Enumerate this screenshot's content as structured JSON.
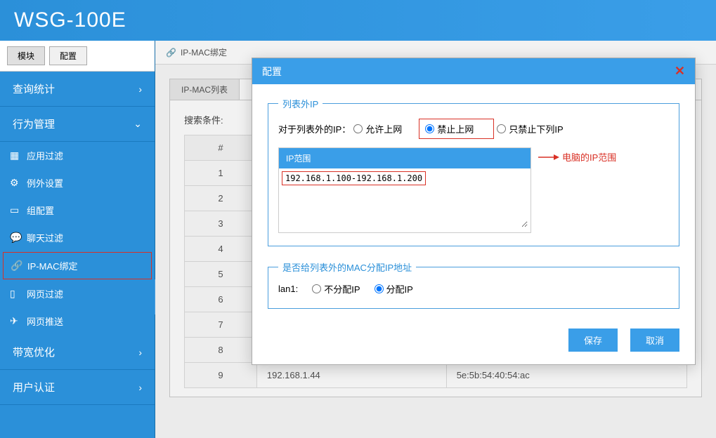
{
  "header": {
    "logo": "WSG-100E"
  },
  "sidebar": {
    "tabs": {
      "module": "模块",
      "config": "配置"
    },
    "sections": [
      {
        "label": "查询统计",
        "expanded": false
      },
      {
        "label": "行为管理",
        "expanded": true,
        "items": [
          {
            "icon": "grid",
            "label": "应用过滤"
          },
          {
            "icon": "gear",
            "label": "例外设置"
          },
          {
            "icon": "card",
            "label": "组配置"
          },
          {
            "icon": "chat",
            "label": "聊天过滤"
          },
          {
            "icon": "link",
            "label": "IP-MAC绑定",
            "highlighted": true
          },
          {
            "icon": "page",
            "label": "网页过滤"
          },
          {
            "icon": "send",
            "label": "网页推送"
          }
        ]
      },
      {
        "label": "带宽优化",
        "expanded": false
      },
      {
        "label": "用户认证",
        "expanded": false
      }
    ]
  },
  "breadcrumb": {
    "text": "IP-MAC绑定"
  },
  "panel": {
    "tab": "IP-MAC列表",
    "search_label": "搜索条件:",
    "rows": [
      "1",
      "2",
      "3",
      "4",
      "5",
      "6",
      "7",
      "8",
      "9"
    ],
    "header": "#",
    "row9_ip": "192.168.1.44",
    "row9_mac": "5e:5b:54:40:54:ac"
  },
  "modal": {
    "title": "配置",
    "fieldset1": {
      "legend": "列表外IP",
      "label": "对于列表外的IP：",
      "opt_allow": "允许上网",
      "opt_deny": "禁止上网",
      "opt_only": "只禁止下列IP",
      "ip_range_header": "IP范围",
      "ip_value": "192.168.1.100-192.168.1.200",
      "note": "电脑的IP范围"
    },
    "fieldset2": {
      "legend": "是否给列表外的MAC分配IP地址",
      "lan_label": "lan1:",
      "opt_noalloc": "不分配IP",
      "opt_alloc": "分配IP"
    },
    "buttons": {
      "save": "保存",
      "cancel": "取消"
    }
  }
}
